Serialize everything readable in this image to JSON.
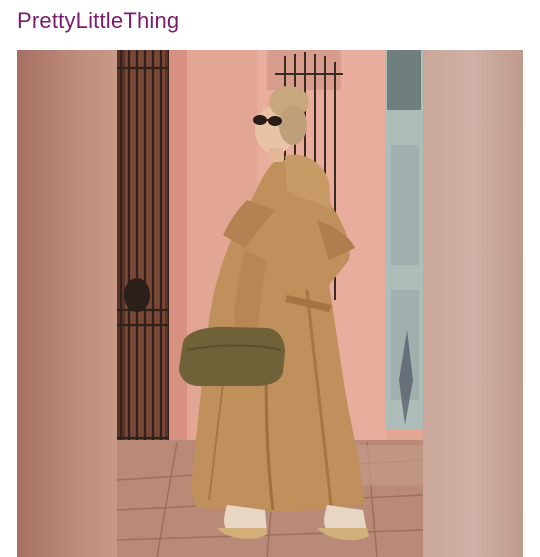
{
  "header": {
    "brand_name": "PrettyLittleThing"
  },
  "colors": {
    "brand": "#7c1a6b",
    "wall": "#e3a594",
    "coat": "#bf8f5c",
    "bag": "#6f6138",
    "gate": "#3a2a22",
    "door": "#aebcba"
  },
  "post": {
    "image_alt": "Woman in a long camel trench coat carrying an olive clutch bag beside a pink wall and iron gate"
  }
}
